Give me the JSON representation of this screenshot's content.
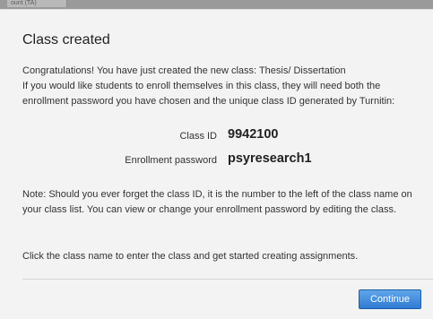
{
  "background": {
    "tab_label": "ount (TA)"
  },
  "dialog": {
    "title": "Class created",
    "intro_line1": "Congratulations! You have just created the new class: Thesis/ Dissertation",
    "intro_line2": "If you would like students to enroll themselves in this class, they will need both the enrollment password you have chosen and the unique class ID generated by Turnitin:",
    "class_id_label": "Class ID",
    "class_id_value": "9942100",
    "password_label": "Enrollment password",
    "password_value": "psyresearch1",
    "note": "Note: Should you ever forget the class ID, it is the number to the left of the class name on your class list. You can view or change your enrollment password by editing the class.",
    "instruction": "Click the class name to enter the class and get started creating assignments.",
    "continue_label": "Continue"
  },
  "colors": {
    "dialog_background": "#f3f3f3",
    "button_accent": "#2f7bd3",
    "backdrop": "#9a9a9a"
  }
}
